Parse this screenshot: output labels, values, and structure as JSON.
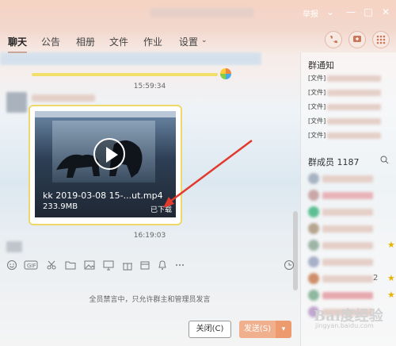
{
  "window": {
    "skin_label": "举报",
    "controls": [
      "minimize",
      "maximize",
      "close"
    ]
  },
  "tabs": [
    {
      "label": "聊天",
      "active": true
    },
    {
      "label": "公告"
    },
    {
      "label": "相册"
    },
    {
      "label": "文件"
    },
    {
      "label": "作业"
    },
    {
      "label": "设置"
    }
  ],
  "chat": {
    "time1": "15:59:34",
    "time2": "16:19:03",
    "video": {
      "filename": "kk 2019-03-08 15-...ut.mp4",
      "size": "233.9MB",
      "status": "已下载"
    }
  },
  "compose": {
    "mute_note": "全员禁言中，只允许群主和管理员发言",
    "close_label": "关闭(C)",
    "send_label": "发送(S)",
    "dropdown_glyph": "▾"
  },
  "right_panel": {
    "notice_title": "群通知",
    "notices": [
      "[文件]",
      "[文件]",
      "[文件]",
      "[文件]",
      "[文件]"
    ],
    "members_title": "群成员 1187",
    "member_badge": "2"
  },
  "watermark": {
    "text": "Bai度经验",
    "sub": "jingyan.baidu.com"
  },
  "colors": {
    "accent": "#c9785a",
    "send": "#f0b08e",
    "card_border": "#efd86a",
    "arrow": "#e23a2c"
  }
}
